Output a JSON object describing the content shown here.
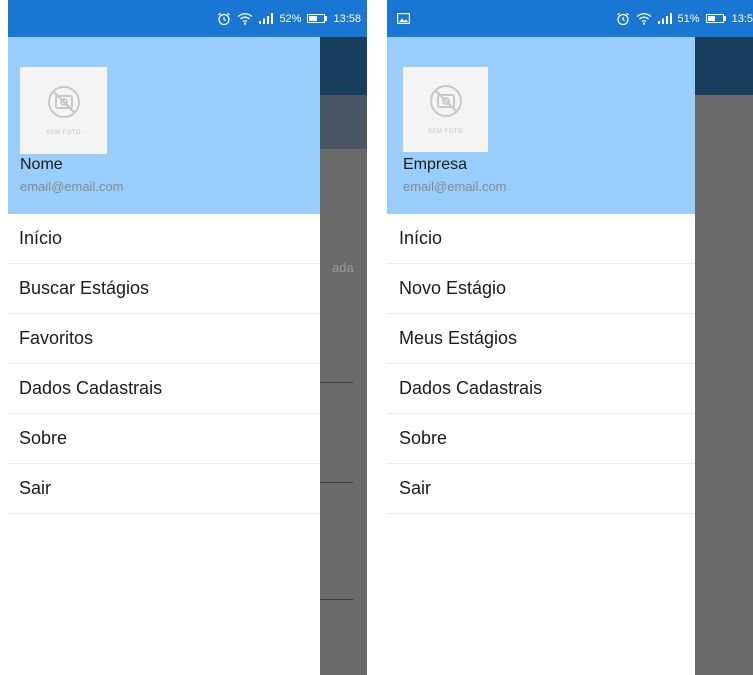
{
  "left_screen": {
    "status": {
      "battery": "52%",
      "battery_fraction": 0.52,
      "time": "13:58"
    },
    "drawer": {
      "avatar_caption": "SEM FOTO",
      "name": "Nome",
      "email": "email@email.com",
      "menu": [
        "Início",
        "Buscar Estágios",
        "Favoritos",
        "Dados Cadastrais",
        "Sobre",
        "Sair"
      ]
    },
    "background_text": "ada"
  },
  "right_screen": {
    "status": {
      "battery": "51%",
      "battery_fraction": 0.51,
      "time": "13:5"
    },
    "drawer": {
      "avatar_caption": "SEM FOTO",
      "name": "Empresa",
      "email": "email@email.com",
      "menu": [
        "Início",
        "Novo Estágio",
        "Meus Estágios",
        "Dados Cadastrais",
        "Sobre",
        "Sair"
      ]
    }
  },
  "colors": {
    "status_bar": "#1976d2",
    "drawer_header": "#99cdfa",
    "toolbar_behind": "#173e5c",
    "scrim": "#6a6a6a"
  },
  "icons": [
    "alarm-icon",
    "wifi-icon",
    "signal-icon",
    "battery-icon",
    "image-notification-icon",
    "no-photo-icon"
  ]
}
